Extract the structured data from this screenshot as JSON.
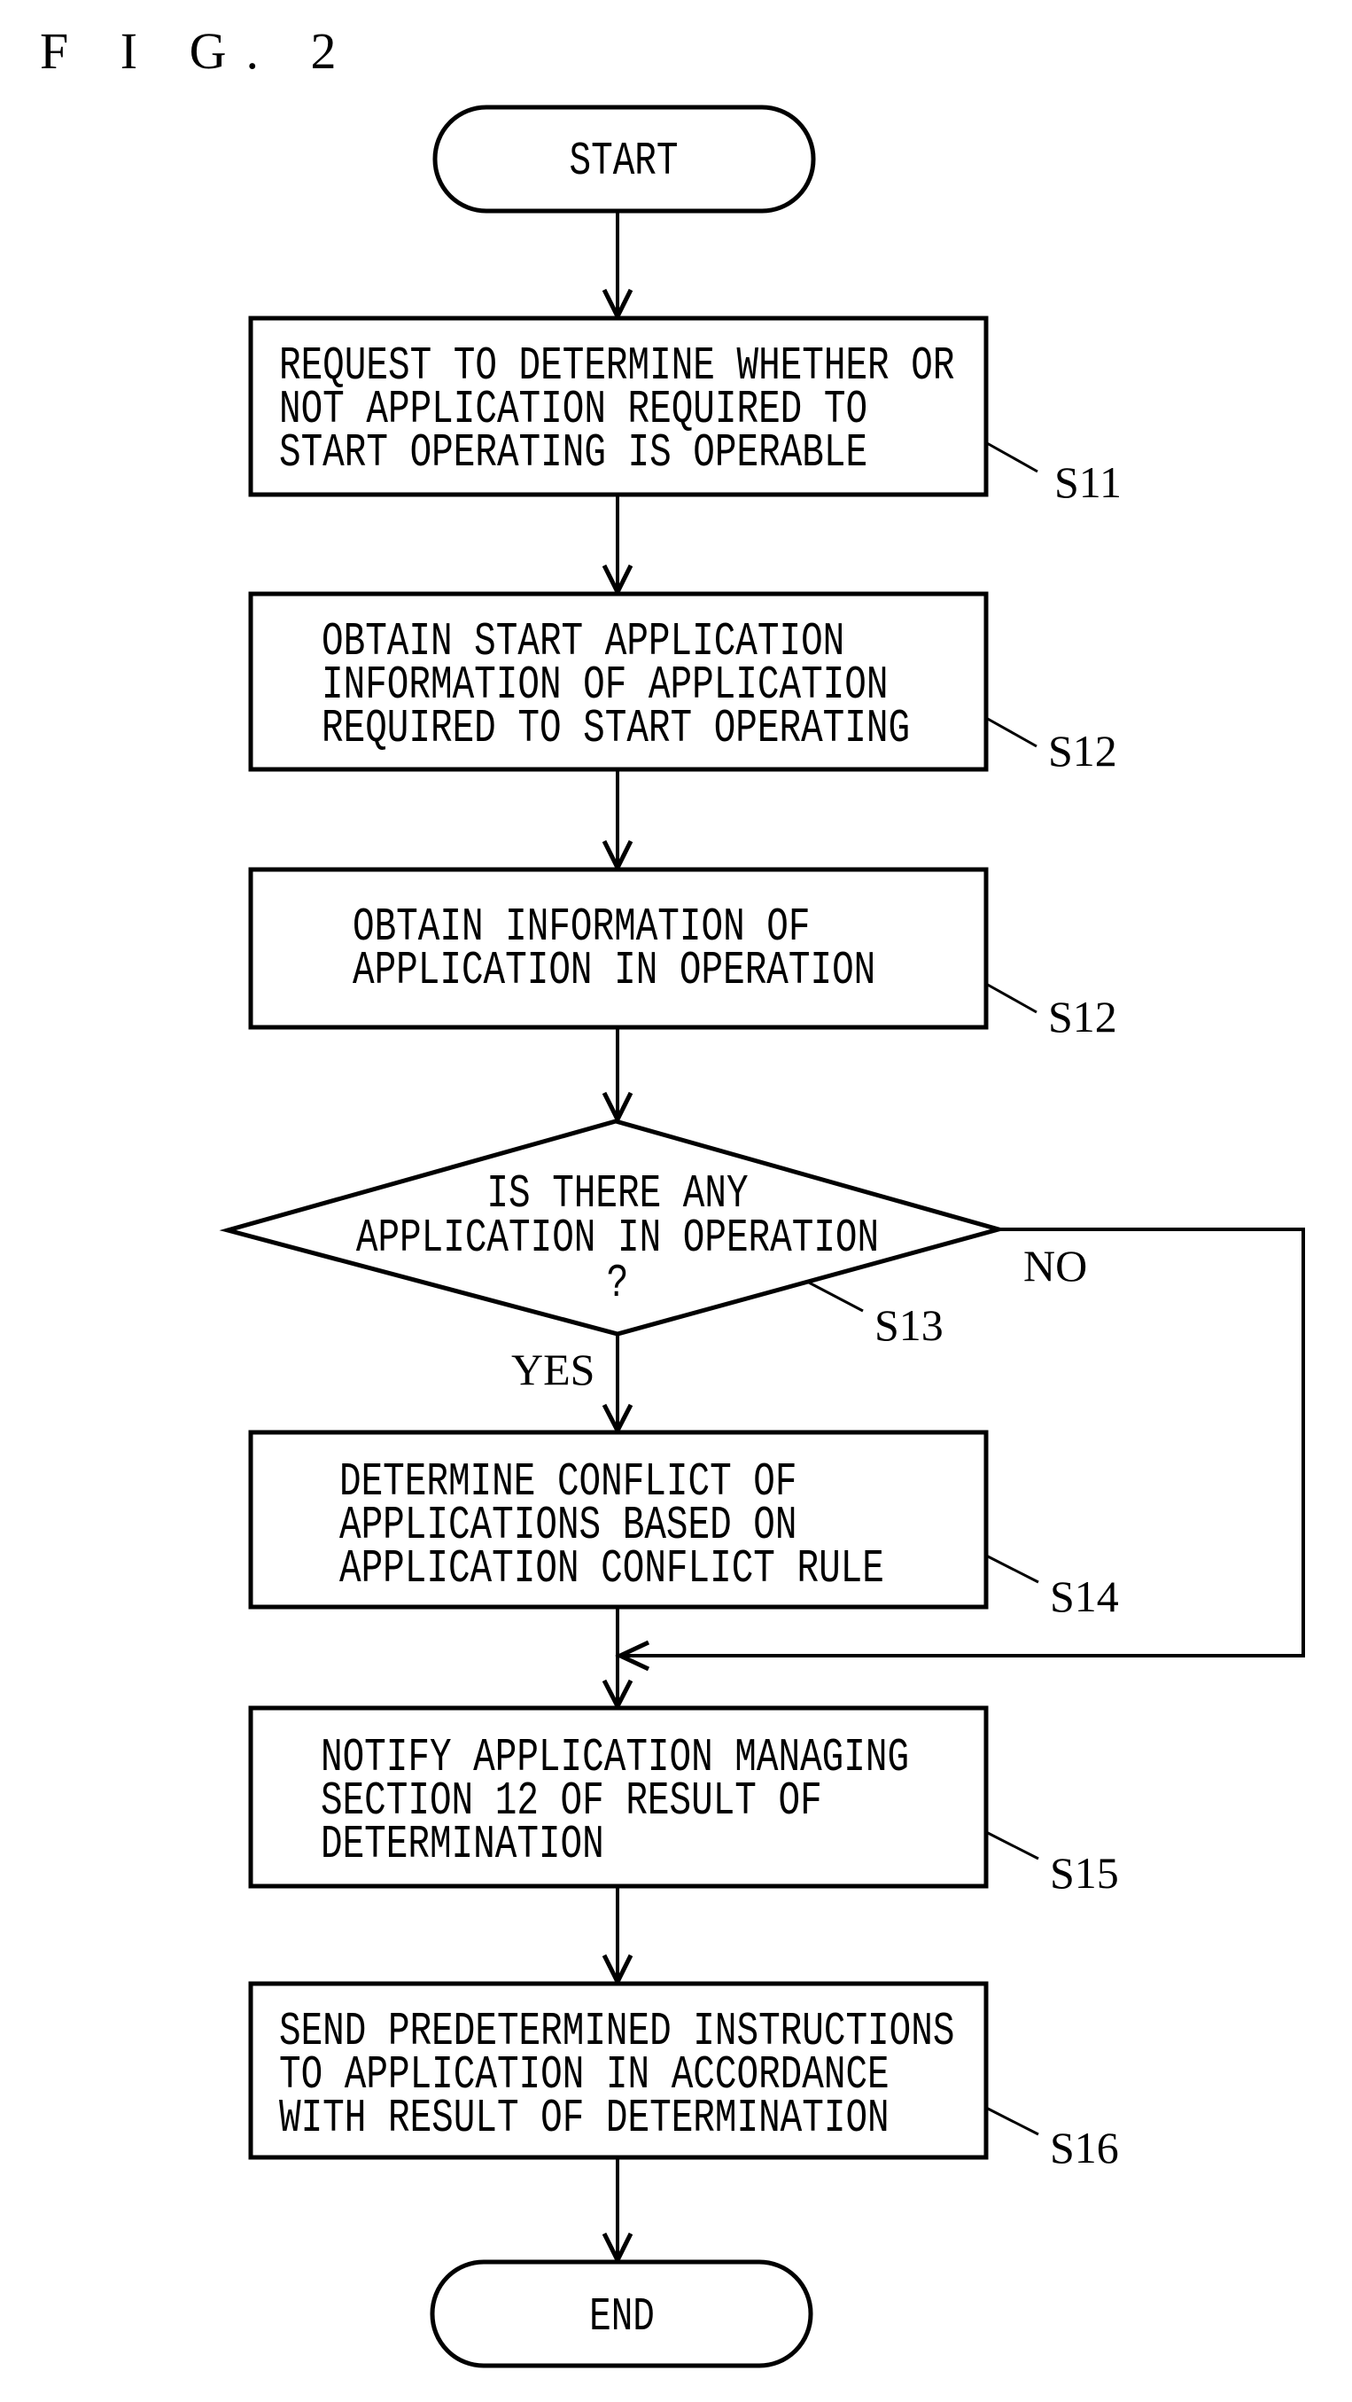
{
  "figure": {
    "title": "F I G. 2"
  },
  "flowchart": {
    "start": "START",
    "end": "END",
    "steps": [
      {
        "id": "S11",
        "lines": [
          "REQUEST TO DETERMINE WHETHER OR",
          "NOT APPLICATION REQUIRED TO",
          "START OPERATING IS OPERABLE"
        ]
      },
      {
        "id": "S12",
        "lines": [
          "OBTAIN START APPLICATION",
          "INFORMATION OF APPLICATION",
          "REQUIRED TO START OPERATING"
        ]
      },
      {
        "id": "S12",
        "lines": [
          "OBTAIN INFORMATION OF",
          "APPLICATION IN OPERATION"
        ]
      },
      {
        "id": "S14",
        "lines": [
          "DETERMINE CONFLICT OF",
          "APPLICATIONS BASED ON",
          "APPLICATION CONFLICT RULE"
        ]
      },
      {
        "id": "S15",
        "lines": [
          "NOTIFY APPLICATION MANAGING",
          "SECTION 12 OF RESULT OF",
          "DETERMINATION"
        ]
      },
      {
        "id": "S16",
        "lines": [
          "SEND PREDETERMINED INSTRUCTIONS",
          "TO APPLICATION IN ACCORDANCE",
          "WITH RESULT OF DETERMINATION"
        ]
      }
    ],
    "decision": {
      "id": "S13",
      "lines": [
        "IS THERE ANY",
        "APPLICATION IN OPERATION",
        "?"
      ],
      "yes_label": "YES",
      "no_label": "NO"
    }
  }
}
